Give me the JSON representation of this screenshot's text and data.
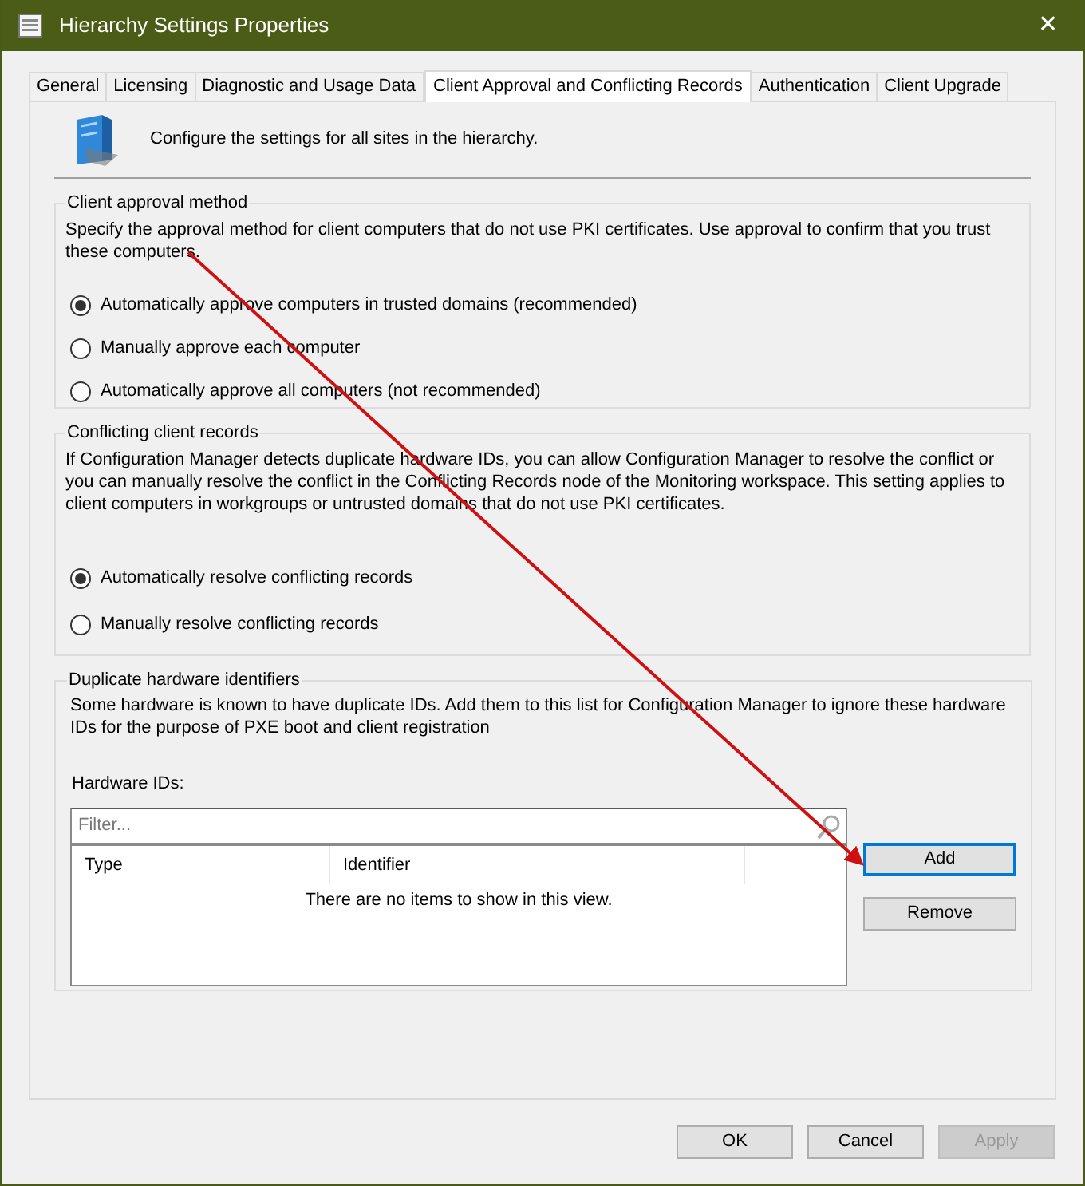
{
  "window": {
    "title": "Hierarchy Settings Properties",
    "close": "✕"
  },
  "tabs": [
    {
      "label": "General",
      "selected": false
    },
    {
      "label": "Licensing",
      "selected": false
    },
    {
      "label": "Diagnostic and Usage Data",
      "selected": false
    },
    {
      "label": "Client Approval and Conflicting Records",
      "selected": true
    },
    {
      "label": "Authentication",
      "selected": false
    },
    {
      "label": "Client Upgrade",
      "selected": false
    }
  ],
  "header": {
    "text": "Configure the settings for all sites in the hierarchy."
  },
  "groups": [
    {
      "title": "Client approval method",
      "description": "Specify the approval method for client computers that do not use PKI certificates. Use approval to confirm that you trust these computers.",
      "options": [
        {
          "label": "Automatically approve computers in trusted domains (recommended)",
          "selected": true
        },
        {
          "label": "Manually approve each computer",
          "selected": false
        },
        {
          "label": "Automatically approve all computers (not recommended)",
          "selected": false
        }
      ]
    },
    {
      "title": "Conflicting client records",
      "description": "If Configuration Manager detects duplicate hardware IDs, you can allow Configuration Manager to resolve the conflict or you can manually resolve the conflict in the Conflicting Records node of the Monitoring workspace. This setting applies to client computers in workgroups or untrusted domains that do not use PKI certificates.",
      "options": [
        {
          "label": "Automatically resolve conflicting records",
          "selected": true
        },
        {
          "label": "Manually resolve conflicting records",
          "selected": false
        }
      ]
    }
  ],
  "hardware": {
    "title": "Duplicate hardware identifiers",
    "description": "Some hardware is known to have duplicate IDs. Add them to this list for Configuration Manager to ignore these hardware IDs for the purpose of PXE boot and client registration",
    "list_label": "Hardware IDs:",
    "filter": {
      "placeholder": "Filter..."
    },
    "columns": [
      "Type",
      "Identifier"
    ],
    "empty_message": "There are no items to show in this view.",
    "buttons": [
      {
        "label": "Add",
        "focused": true
      },
      {
        "label": "Remove",
        "focused": false
      }
    ]
  },
  "buttons": [
    {
      "label": "OK",
      "disabled": false
    },
    {
      "label": "Cancel",
      "disabled": false
    },
    {
      "label": "Apply",
      "disabled": true
    }
  ]
}
